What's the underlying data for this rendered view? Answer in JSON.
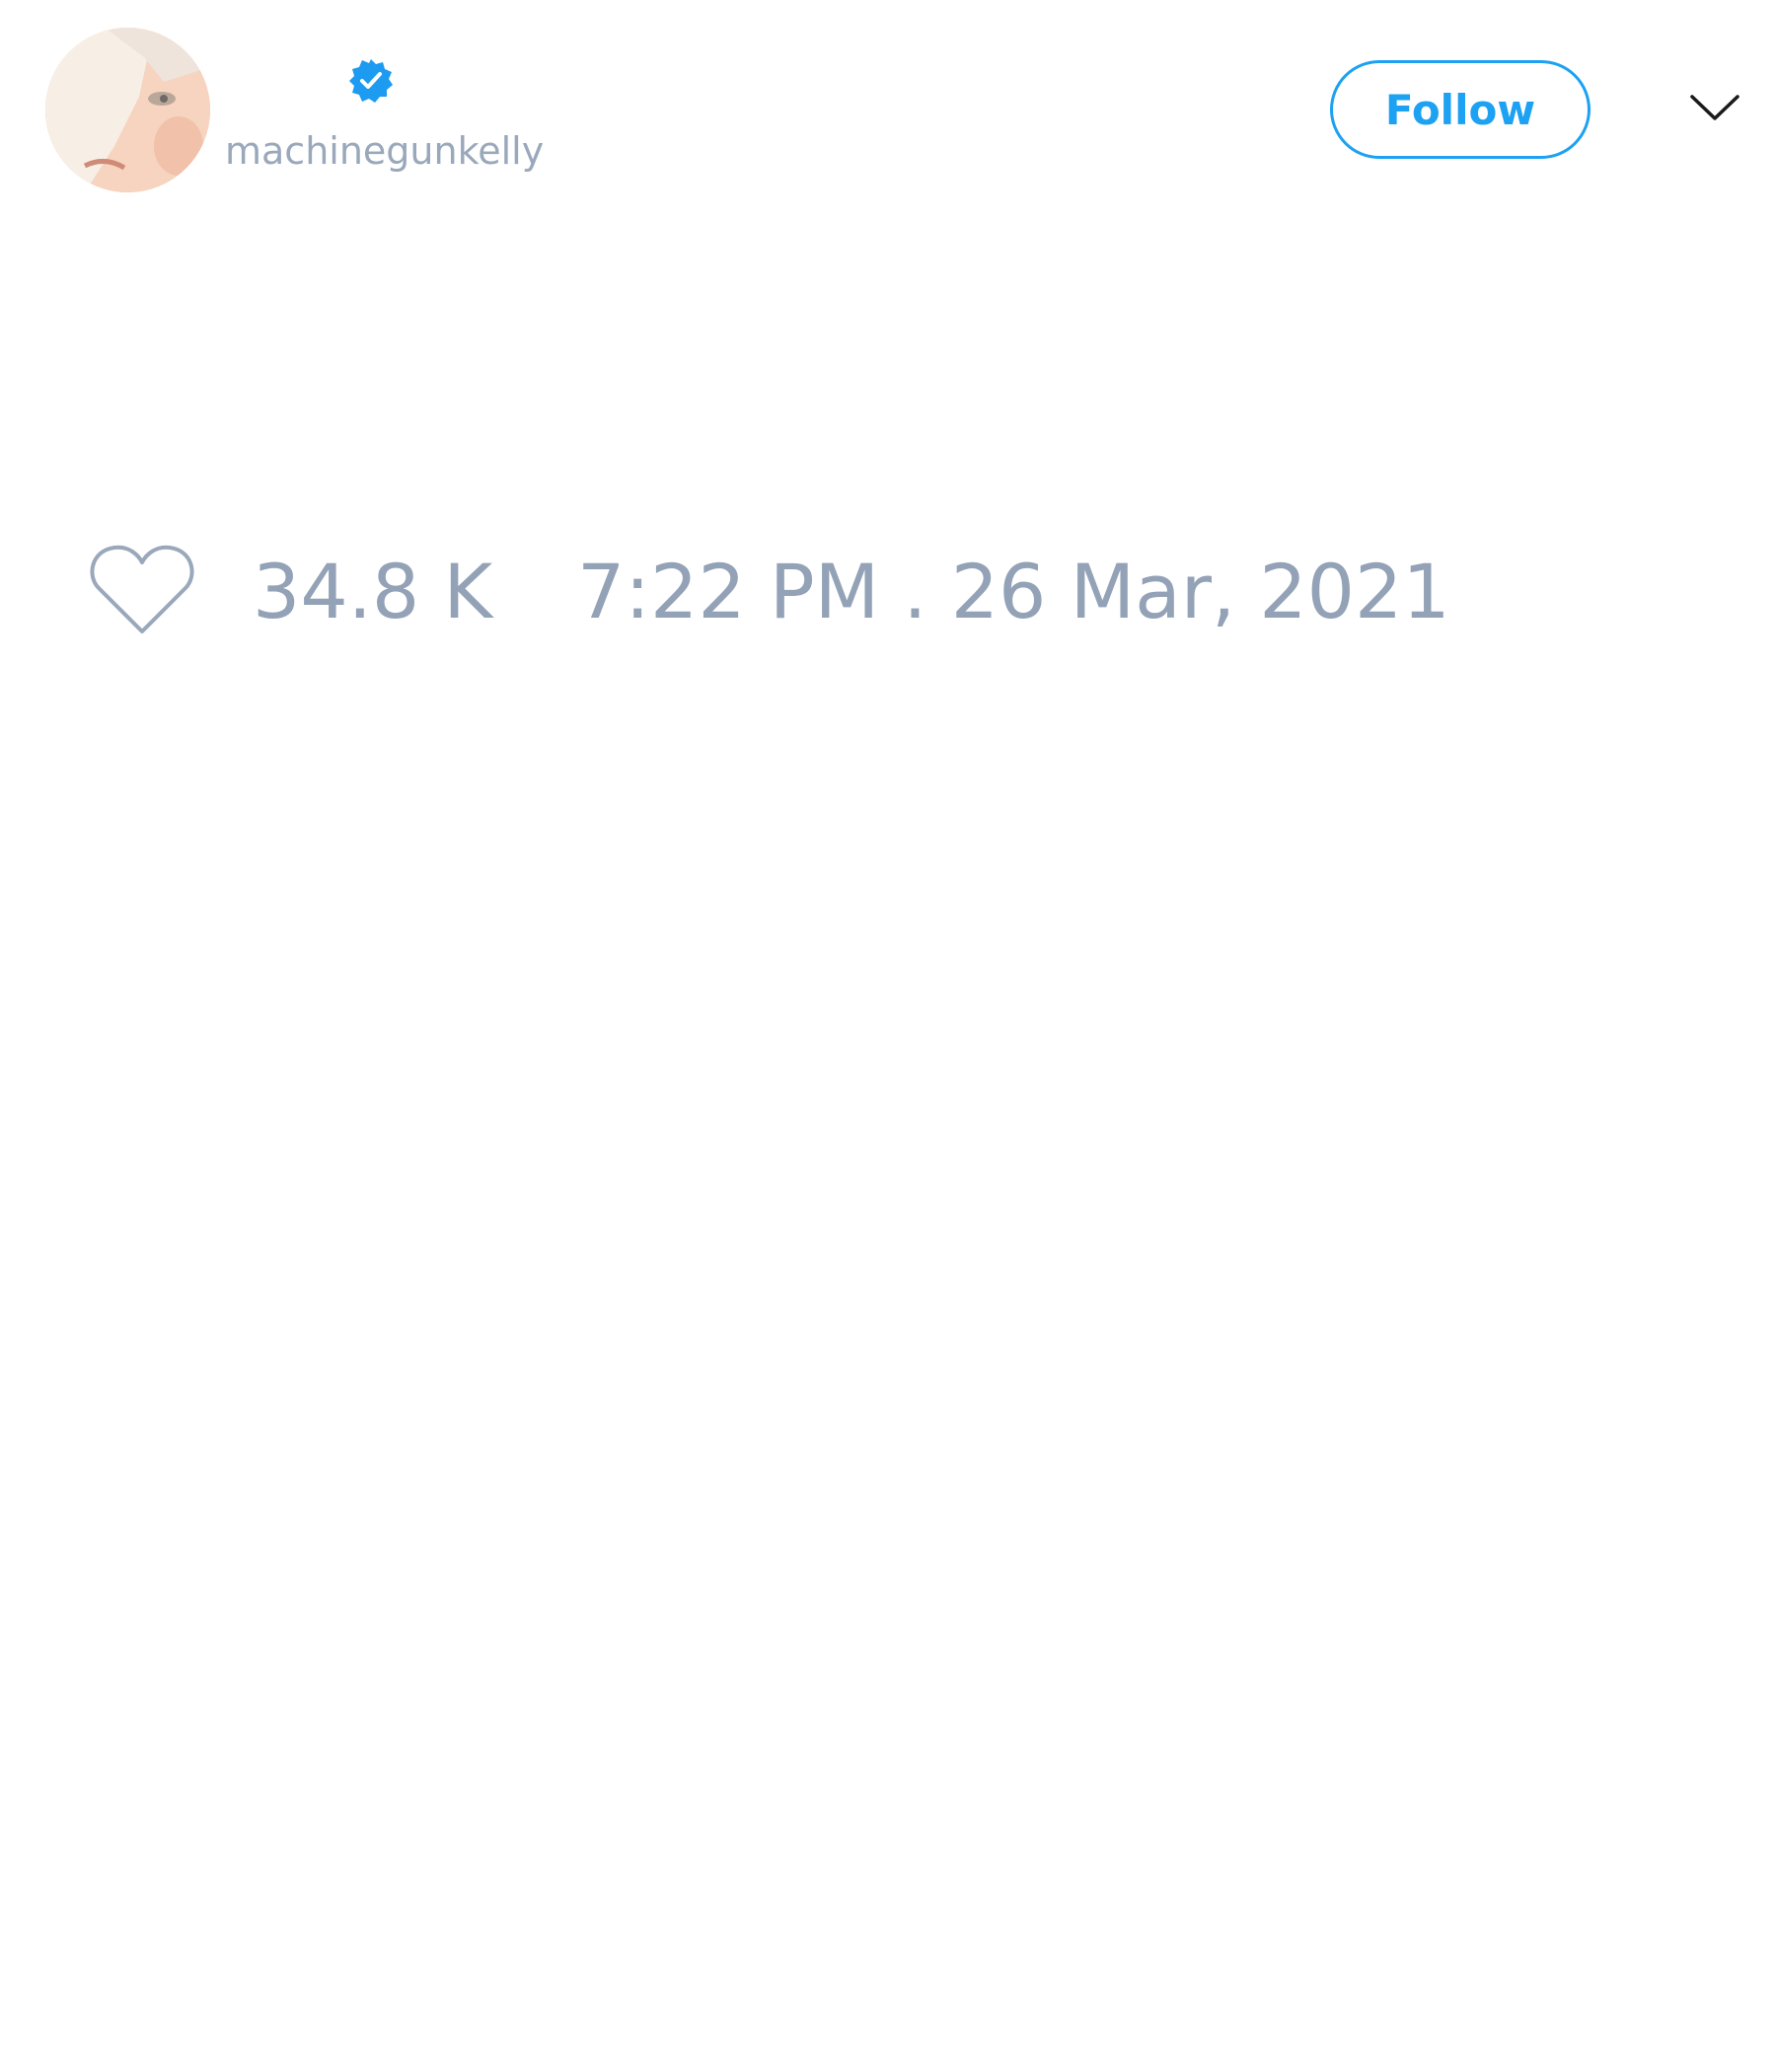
{
  "author": {
    "handle": "machinegunkelly",
    "verified": true,
    "avatar_icon": "profile-photo"
  },
  "actions": {
    "follow_label": "Follow",
    "menu_icon": "chevron-down-icon"
  },
  "stats": {
    "like_icon": "heart-outline-icon",
    "likes": "34.8 K",
    "timestamp": "7:22 PM . 26 Mar, 2021"
  },
  "colors": {
    "accent": "#1da1f2",
    "muted_text": "#93a2b6",
    "background": "#ffffff"
  }
}
